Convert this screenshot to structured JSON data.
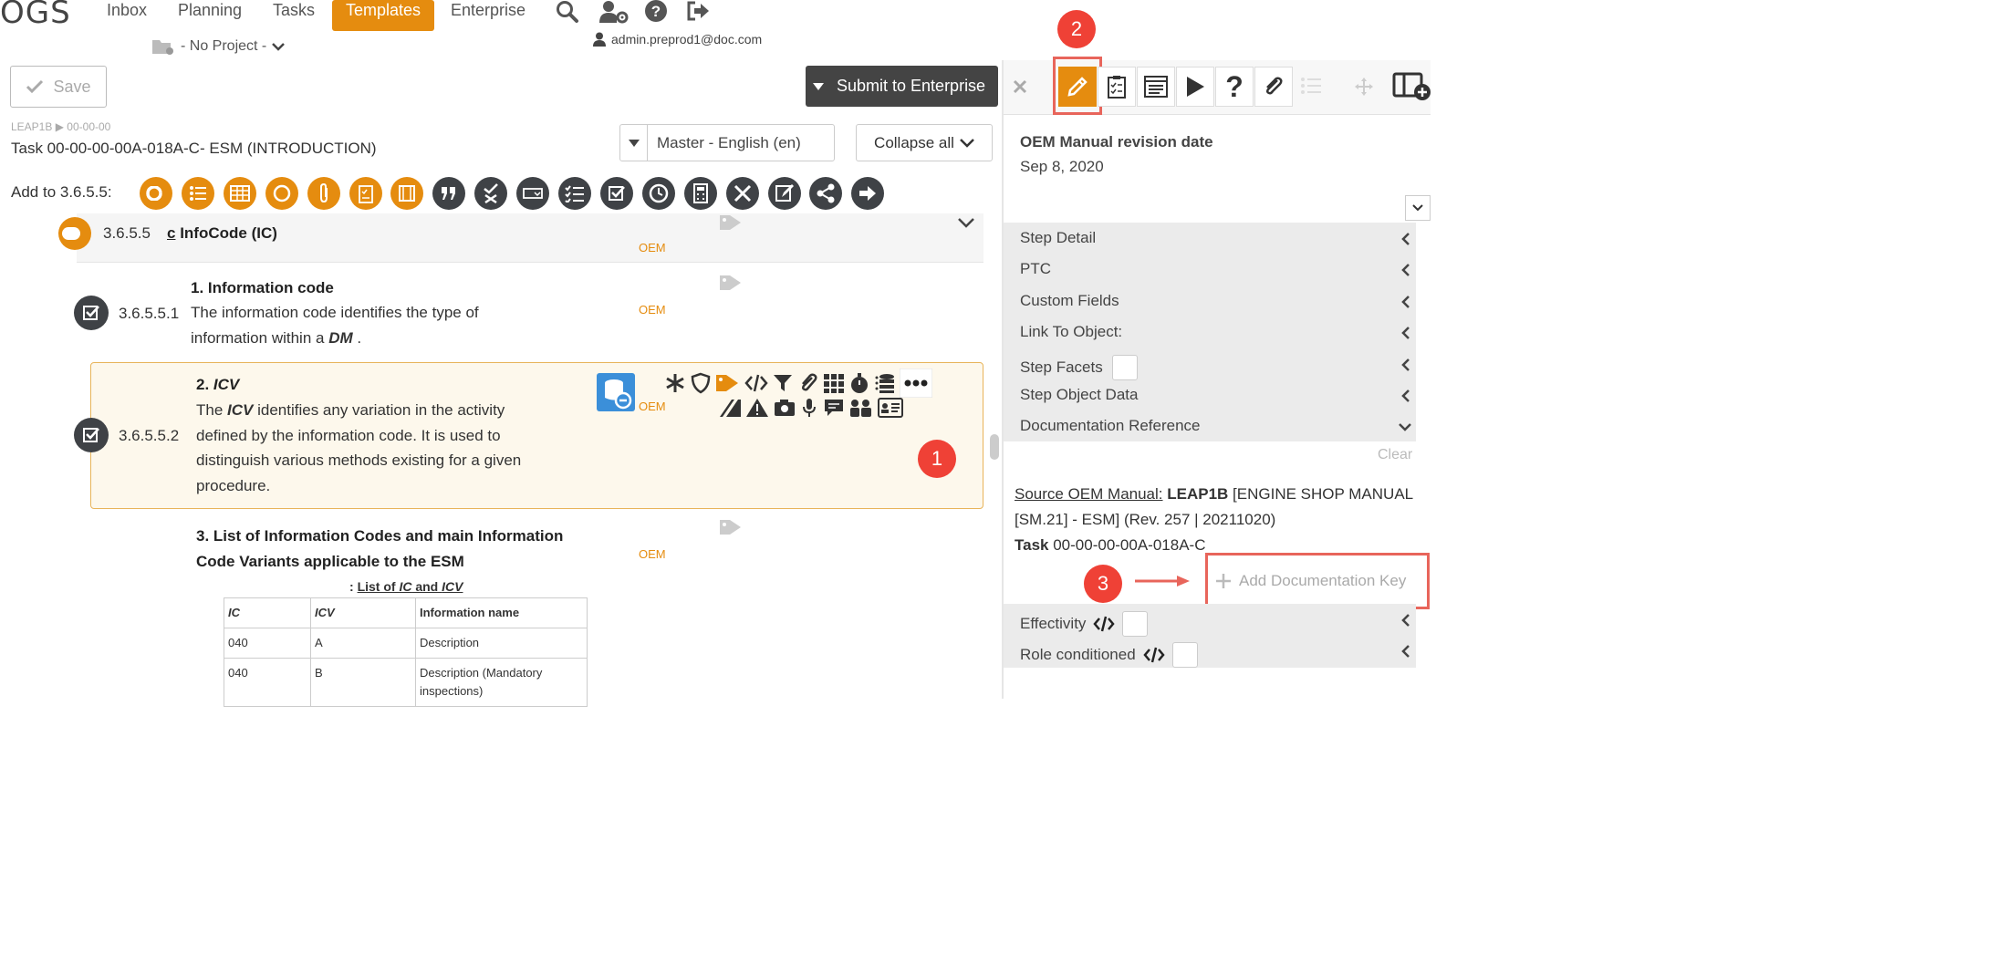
{
  "app": {
    "logo_text": "OGS"
  },
  "nav": {
    "items": [
      "Inbox",
      "Planning",
      "Tasks",
      "Templates",
      "Enterprise"
    ],
    "active": "Templates",
    "icons": [
      "search-icon",
      "user-settings-icon",
      "help-icon",
      "logout-icon"
    ],
    "project": "- No Project -",
    "user": "admin.preprod1@doc.com"
  },
  "toolbar": {
    "save_label": "Save",
    "submit_label": "Submit to Enterprise"
  },
  "task": {
    "breadcrumb_root": "LEAP1B",
    "breadcrumb_sep": "▶",
    "breadcrumb_leaf": "00-00-00",
    "title": "Task 00-00-00-00A-018A-C- ESM (INTRODUCTION)"
  },
  "language_select": {
    "value": "Master - English (en)"
  },
  "collapse_label": "Collapse all",
  "add_to": {
    "label": "Add to 3.6.5.5:",
    "buttons": [
      {
        "icon": "section-icon",
        "color": "#e58c0f"
      },
      {
        "icon": "list-icon",
        "color": "#e58c0f"
      },
      {
        "icon": "table-icon",
        "color": "#e58c0f"
      },
      {
        "icon": "circle-icon",
        "color": "#e58c0f"
      },
      {
        "icon": "attachment-icon",
        "color": "#e58c0f"
      },
      {
        "icon": "checklist-icon",
        "color": "#e58c0f"
      },
      {
        "icon": "film-icon",
        "color": "#e58c0f"
      },
      {
        "icon": "quote-icon",
        "color": "#3f4246"
      },
      {
        "icon": "check-x-icon",
        "color": "#3f4246"
      },
      {
        "icon": "input-field-icon",
        "color": "#3f4246"
      },
      {
        "icon": "task-list-icon",
        "color": "#3f4246"
      },
      {
        "icon": "checkbox-icon",
        "color": "#3f4246"
      },
      {
        "icon": "clock-icon",
        "color": "#3f4246"
      },
      {
        "icon": "calculator-icon",
        "color": "#3f4246"
      },
      {
        "icon": "tools-icon",
        "color": "#3f4246"
      },
      {
        "icon": "signature-icon",
        "color": "#3f4246"
      },
      {
        "icon": "share-icon",
        "color": "#3f4246"
      },
      {
        "icon": "arrow-right-icon",
        "color": "#3f4246"
      }
    ]
  },
  "section": {
    "number": "3.6.5.5",
    "prefix": "c",
    "title": "InfoCode (IC)",
    "source": "OEM"
  },
  "steps": [
    {
      "number": "3.6.5.5.1",
      "title": "1. Information code",
      "text_1": "The information code identifies the type of",
      "text_2_pre": "information within a ",
      "text_2_em": "DM",
      "text_2_post": " .",
      "source": "OEM"
    },
    {
      "number": "3.6.5.5.2",
      "title_num": "2. ",
      "title_em": "ICV",
      "text_1_pre": "The ",
      "text_1_em": "ICV",
      "text_1_post": " identifies any variation in the activity",
      "text_2": "defined by the information code. It is used to",
      "text_3": "distinguish various methods existing for a given",
      "text_4": "procedure.",
      "source": "OEM"
    },
    {
      "title_1": "3. List of Information Codes and main Information",
      "title_2": "Code Variants applicable to the ESM",
      "source": "OEM",
      "table_caption_pre": ": ",
      "table_caption_a": "List of ",
      "table_caption_ic": "IC",
      "table_caption_and": " and ",
      "table_caption_icv": "ICV",
      "table_headers": [
        "IC",
        "ICV",
        "Information name"
      ],
      "table_rows": [
        [
          "040",
          "A",
          "Description"
        ],
        [
          "040",
          "B",
          "Description (Mandatory inspections)"
        ]
      ]
    }
  ],
  "annotations": [
    "1",
    "2",
    "3"
  ],
  "right_panel": {
    "tools": [
      "close-icon",
      "pencil-icon",
      "clipboard-check-icon",
      "form-icon",
      "play-icon",
      "question-icon",
      "paperclip-icon",
      "list-icon",
      "move-icon",
      "layout-add-icon"
    ],
    "oem_revision_label": "OEM Manual revision date",
    "oem_revision_value": "Sep 8, 2020",
    "sections": [
      "Step Detail",
      "PTC",
      "Custom Fields",
      "Link To Object:",
      "Step Facets",
      "Step Object Data",
      "Documentation Reference"
    ],
    "clear_label": "Clear",
    "source_label": "Source OEM Manual:",
    "source_manual": "LEAP1B",
    "source_rest": " [ENGINE SHOP MANUAL [SM.21] - ESM] (Rev. 257 | 20211020)",
    "task_label": "Task",
    "task_value": " 00-00-00-00A-018A-C",
    "add_doc_key": "Add Documentation Key",
    "bottom_sections": [
      "Effectivity",
      "Role conditioned"
    ]
  },
  "colors": {
    "accent": "#e58c0f",
    "dark": "#3f4246",
    "annotation": "#ef4136"
  }
}
